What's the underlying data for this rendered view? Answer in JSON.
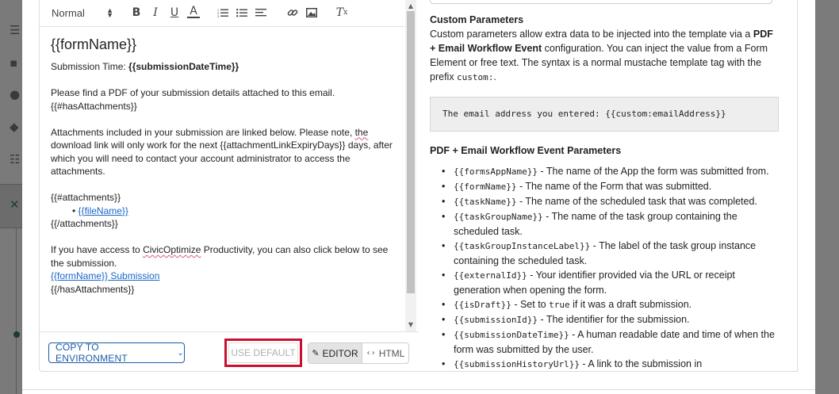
{
  "toolbar": {
    "format_select": "Normal",
    "icons": [
      "bold-icon",
      "italic-icon",
      "underline-icon",
      "text-color-icon",
      "ordered-list-icon",
      "bullet-list-icon",
      "align-icon",
      "link-icon",
      "image-icon",
      "clear-format-icon"
    ]
  },
  "editor": {
    "heading": "{{formName}}",
    "submission_time_label": "Submission Time: ",
    "submission_time_value": "{{submissionDateTime}}",
    "pdf_line": "Please find a PDF of your submission details attached to this email.",
    "has_attachments_open": "{{#hasAttachments}}",
    "attachments_p1": "Attachments included in your submission are linked below. Please note, ",
    "attachments_the": "the",
    "attachments_p2": " download link will only work for the next {{attachmentLinkExpiryDays}} days, after which you will need to contact your account administrator to access the attachments.",
    "attachments_open": "{{#attachments}}",
    "file_name_link": "{{fileName}}",
    "attachments_close": "{{/attachments}}",
    "access_p1": "If you have access to ",
    "access_brand": "CivicOptimize",
    "access_p2": " Productivity, you can also click below to see the submission.",
    "submission_link": "{{formName}} Submission",
    "has_attachments_close": "{{/hasAttachments}}"
  },
  "footer": {
    "copy_button": "COPY TO ENVIRONMENT",
    "default_button": "USE DEFAULT",
    "editor_tab": "EDITOR",
    "html_tab": "HTML"
  },
  "docs": {
    "custom_title": "Custom Parameters",
    "custom_text_1": "Custom parameters allow extra data to be injected into the template via a ",
    "custom_bold": "PDF + Email Workflow Event",
    "custom_text_2": " configuration. You can inject the value from a Form Element or free text. The syntax is a normal mustache template tag with the prefix ",
    "custom_prefix": "custom:",
    "custom_text_3": ".",
    "code_example": "The email address you entered: {{custom:emailAddress}}",
    "event_title": "PDF + Email Workflow Event Parameters",
    "params": [
      {
        "code": "{{formsAppName}}",
        "desc": " - The name of the App the form was submitted from."
      },
      {
        "code": "{{formName}}",
        "desc": " - The name of the Form that was submitted."
      },
      {
        "code": "{{taskName}}",
        "desc": " - The name of the scheduled task that was completed."
      },
      {
        "code": "{{taskGroupName}}",
        "desc": " - The name of the task group containing the scheduled task."
      },
      {
        "code": "{{taskGroupInstanceLabel}}",
        "desc": " - The label of the task group instance containing the scheduled task."
      },
      {
        "code": "{{externalId}}",
        "desc": " - Your identifier provided via the URL or receipt generation when opening the form."
      },
      {
        "code": "{{isDraft}}",
        "desc_pre": " - Set to ",
        "inline": "true",
        "desc": " if it was a draft submission."
      },
      {
        "code": "{{submissionId}}",
        "desc": " - The identifier for the submission."
      },
      {
        "code": "{{submissionDateTime}}",
        "desc": " - A human readable date and time of when the form was submitted by the user."
      },
      {
        "code": "{{submissionHistoryUrl}}",
        "desc": " - A link to the submission in"
      }
    ]
  }
}
